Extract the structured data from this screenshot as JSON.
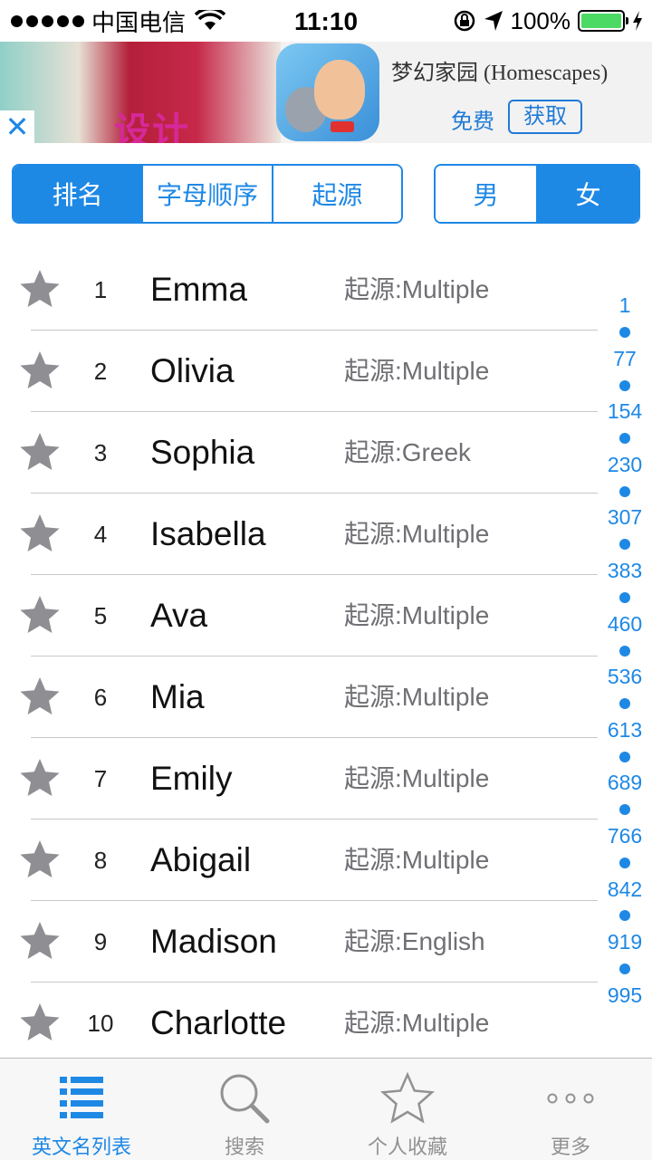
{
  "status_bar": {
    "carrier": "中国电信",
    "time": "11:10",
    "battery": "100%"
  },
  "ad": {
    "art_text": "设计",
    "title": "梦幻家园 (Homescapes)",
    "free_label": "免费",
    "get_button": "获取",
    "close": "✕"
  },
  "sort_tabs": [
    "排名",
    "字母顺序",
    "起源"
  ],
  "sort_selected": "排名",
  "gender_tabs": [
    "男",
    "女"
  ],
  "gender_selected": "女",
  "origin_prefix": "起源:",
  "names": [
    {
      "rank": "1",
      "name": "Emma",
      "origin": "起源:Multiple"
    },
    {
      "rank": "2",
      "name": "Olivia",
      "origin": "起源:Multiple"
    },
    {
      "rank": "3",
      "name": "Sophia",
      "origin": "起源:Greek"
    },
    {
      "rank": "4",
      "name": "Isabella",
      "origin": "起源:Multiple"
    },
    {
      "rank": "5",
      "name": "Ava",
      "origin": "起源:Multiple"
    },
    {
      "rank": "6",
      "name": "Mia",
      "origin": "起源:Multiple"
    },
    {
      "rank": "7",
      "name": "Emily",
      "origin": "起源:Multiple"
    },
    {
      "rank": "8",
      "name": "Abigail",
      "origin": "起源:Multiple"
    },
    {
      "rank": "9",
      "name": "Madison",
      "origin": "起源:English"
    },
    {
      "rank": "10",
      "name": "Charlotte",
      "origin": "起源:Multiple"
    }
  ],
  "index_bar": [
    "1",
    "77",
    "154",
    "230",
    "307",
    "383",
    "460",
    "536",
    "613",
    "689",
    "766",
    "842",
    "919",
    "995"
  ],
  "tabbar": {
    "items": [
      {
        "label": "英文名列表",
        "icon": "list-icon"
      },
      {
        "label": "搜索",
        "icon": "search-icon"
      },
      {
        "label": "个人收藏",
        "icon": "star-icon"
      },
      {
        "label": "更多",
        "icon": "more-icon"
      }
    ],
    "active": "英文名列表"
  },
  "colors": {
    "accent": "#1e88e5",
    "star": "#8e8e93",
    "battery": "#4cd964"
  }
}
